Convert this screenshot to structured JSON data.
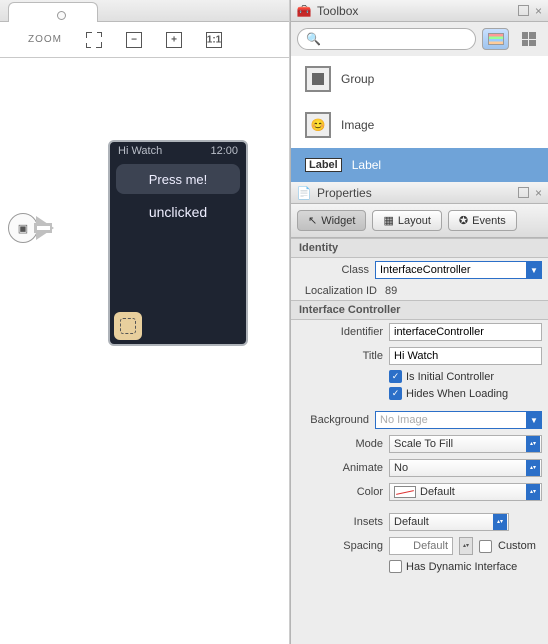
{
  "toolbar": {
    "zoom_label": "ZOOM"
  },
  "watch": {
    "title": "Hi Watch",
    "time": "12:00",
    "button_text": "Press me!",
    "label_text": "unclicked"
  },
  "toolbox": {
    "title": "Toolbox",
    "search_placeholder": "",
    "items": [
      {
        "name": "Group"
      },
      {
        "name": "Image"
      },
      {
        "name": "Label",
        "selected": true
      }
    ]
  },
  "properties": {
    "title": "Properties",
    "tabs": {
      "widget": "Widget",
      "layout": "Layout",
      "events": "Events"
    },
    "sections": {
      "identity": {
        "header": "Identity",
        "class_label": "Class",
        "class_value": "InterfaceController",
        "locid_label": "Localization ID",
        "locid_value": "89"
      },
      "controller": {
        "header": "Interface Controller",
        "identifier_label": "Identifier",
        "identifier_value": "interfaceController",
        "title_label": "Title",
        "title_value": "Hi Watch",
        "is_initial_label": "Is Initial Controller",
        "hides_label": "Hides When Loading",
        "background_label": "Background",
        "background_value": "No Image",
        "mode_label": "Mode",
        "mode_value": "Scale To Fill",
        "animate_label": "Animate",
        "animate_value": "No",
        "color_label": "Color",
        "color_value": "Default",
        "insets_label": "Insets",
        "insets_value": "Default",
        "spacing_label": "Spacing",
        "spacing_value": "Default",
        "custom_label": "Custom",
        "dynamic_label": "Has Dynamic Interface"
      }
    }
  }
}
